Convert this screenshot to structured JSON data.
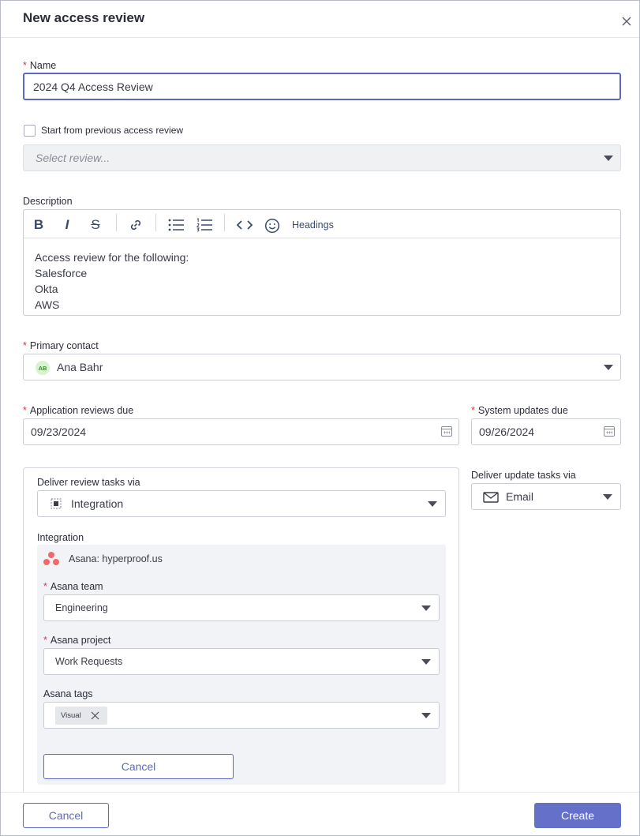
{
  "dialog": {
    "title": "New access review"
  },
  "name_field": {
    "label": "Name",
    "value": "2024 Q4 Access Review"
  },
  "previous": {
    "checkbox_label": "Start from previous access review",
    "select_placeholder": "Select review..."
  },
  "description": {
    "label": "Description",
    "toolbar": {
      "bold": "B",
      "italic": "I",
      "strike": "S",
      "headings": "Headings"
    },
    "lines": [
      "Access review for the following:",
      "Salesforce",
      "Okta",
      "AWS"
    ]
  },
  "primary_contact": {
    "label": "Primary contact",
    "initials": "AB",
    "name": "Ana Bahr"
  },
  "app_reviews_due": {
    "label": "Application reviews due",
    "value": "09/23/2024"
  },
  "system_updates_due": {
    "label": "System updates due",
    "value": "09/26/2024"
  },
  "review_tasks": {
    "label": "Deliver review tasks via",
    "value": "Integration",
    "integration_label": "Integration",
    "integration_name": "Asana: hyperproof.us",
    "team_label": "Asana team",
    "team_value": "Engineering",
    "project_label": "Asana project",
    "project_value": "Work Requests",
    "tags_label": "Asana tags",
    "tags": [
      "Visual"
    ],
    "cancel_label": "Cancel"
  },
  "update_tasks": {
    "label": "Deliver update tasks via",
    "value": "Email"
  },
  "footer": {
    "cancel": "Cancel",
    "create": "Create"
  },
  "colors": {
    "primary": "#6570c8",
    "focus_border": "#5d68c4",
    "asana": "#f06a6a",
    "required": "#d6384a"
  }
}
